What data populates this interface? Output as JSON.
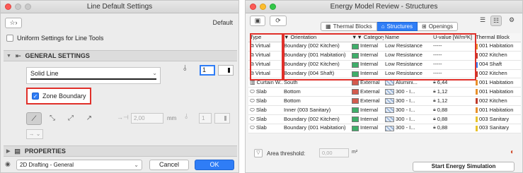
{
  "left_dialog": {
    "title": "Line Default Settings",
    "favorites_glyph": "☆›",
    "default_label": "Default",
    "uniform_label": "Uniform Settings for Line Tools",
    "general_section": "GENERAL SETTINGS",
    "line_type": "Solid Line",
    "pen_number": "1",
    "zone_boundary_label": "Zone Boundary",
    "zone_boundary_checked": true,
    "dimension_value": "2,00",
    "dimension_unit": "mm",
    "small_pen": "1",
    "properties_section": "PROPERTIES",
    "layer_value": "2D Drafting - General",
    "cancel_label": "Cancel",
    "ok_label": "OK"
  },
  "right_window": {
    "title": "Energy Model Review - Structures",
    "tabs": [
      {
        "label": "Thermal Blocks",
        "active": false
      },
      {
        "label": "Structures",
        "active": true
      },
      {
        "label": "Openings",
        "active": false
      }
    ],
    "columns": [
      "Type",
      "Orientation",
      "Category",
      "Name",
      "U-value [W/m²K]",
      "Thermal Block"
    ],
    "rows": [
      {
        "type": "Virtual",
        "orientation": "Boundary (002 Kitchen)",
        "category": "Internal",
        "category_color": "#3fae6a",
        "name": "Low Resistance",
        "u": "-----",
        "thermal_block": "001 Habitation",
        "tb_color": "#e8902a"
      },
      {
        "type": "Virtual",
        "orientation": "Boundary (001 Habitation)",
        "category": "Internal",
        "category_color": "#3fae6a",
        "name": "Low Resistance",
        "u": "-----",
        "thermal_block": "002 Kitchen",
        "tb_color": "#c0392b"
      },
      {
        "type": "Virtual",
        "orientation": "Boundary (002 Kitchen)",
        "category": "Internal",
        "category_color": "#3fae6a",
        "name": "Low Resistance",
        "u": "-----",
        "thermal_block": "004 Shaft",
        "tb_color": "#2f7df6"
      },
      {
        "type": "Virtual",
        "orientation": "Boundary (004 Shaft)",
        "category": "Internal",
        "category_color": "#3fae6a",
        "name": "Low Resistance",
        "u": "-----",
        "thermal_block": "002 Kitchen",
        "tb_color": "#c0392b"
      },
      {
        "type": "Curtain W...",
        "orientation": "South",
        "category": "External",
        "category_color": "#d35b4e",
        "name": "Alumini...",
        "u": "6,44",
        "thermal_block": "001 Habitation",
        "tb_color": "#e8902a"
      },
      {
        "type": "Slab",
        "orientation": "Bottom",
        "category": "External",
        "category_color": "#d35b4e",
        "name": "300 - I...",
        "u": "1,12",
        "thermal_block": "001 Habitation",
        "tb_color": "#e8902a"
      },
      {
        "type": "Slab",
        "orientation": "Bottom",
        "category": "External",
        "category_color": "#d35b4e",
        "name": "300 - I...",
        "u": "1,12",
        "thermal_block": "002 Kitchen",
        "tb_color": "#c0392b"
      },
      {
        "type": "Slab",
        "orientation": "Inner (003 Sanitary)",
        "category": "Internal",
        "category_color": "#3fae6a",
        "name": "300 - I...",
        "u": "0,88",
        "thermal_block": "001 Habitation",
        "tb_color": "#e8902a"
      },
      {
        "type": "Slab",
        "orientation": "Boundary (002 Kitchen)",
        "category": "Internal",
        "category_color": "#3fae6a",
        "name": "300 - I...",
        "u": "0,88",
        "thermal_block": "003 Sanitary",
        "tb_color": "#e8c22a"
      },
      {
        "type": "Slab",
        "orientation": "Boundary (001 Habitation)",
        "category": "Internal",
        "category_color": "#3fae6a",
        "name": "300 - I...",
        "u": "0,88",
        "thermal_block": "003 Sanitary",
        "tb_color": "#e8c22a"
      }
    ],
    "area_threshold_label": "Area threshold:",
    "area_threshold_value": "0,00",
    "area_unit": "m²",
    "simulate_label": "Start Energy Simulation"
  }
}
